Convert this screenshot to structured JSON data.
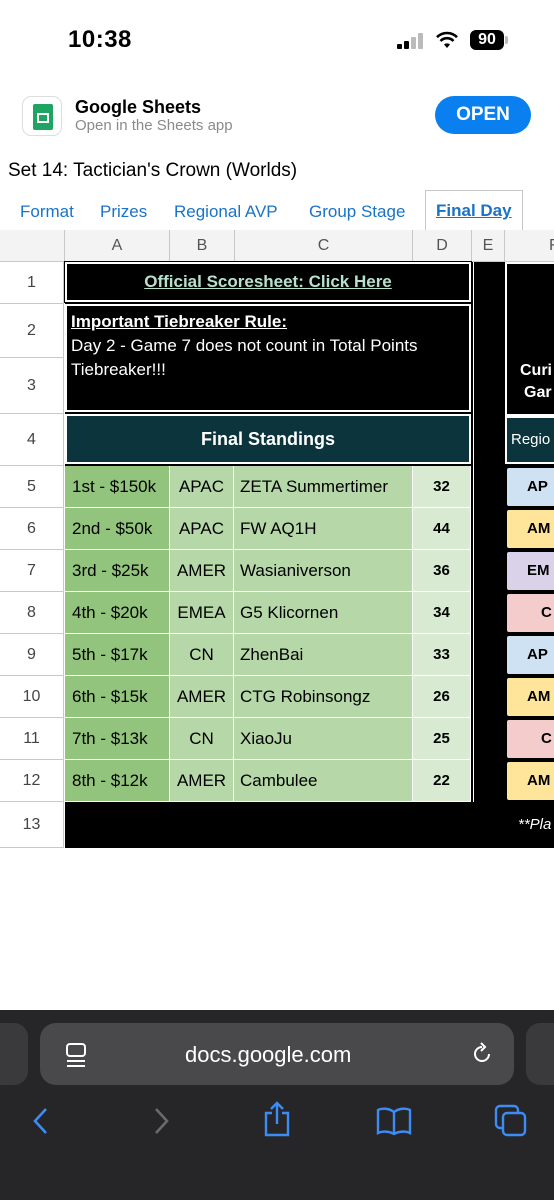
{
  "status": {
    "time": "10:38",
    "battery": "90"
  },
  "banner": {
    "app_name": "Google Sheets",
    "subtitle": "Open in the Sheets app",
    "open_label": "OPEN"
  },
  "doc": {
    "title": "Set 14: Tactician's Crown (Worlds)"
  },
  "tabs": [
    {
      "label": "Format"
    },
    {
      "label": "Prizes"
    },
    {
      "label": "Regional AVP"
    },
    {
      "label": "Group Stage"
    },
    {
      "label": "Final Day"
    }
  ],
  "columns": [
    "A",
    "B",
    "C",
    "D",
    "E",
    "F"
  ],
  "rows": [
    "1",
    "2",
    "3",
    "4",
    "5",
    "6",
    "7",
    "8",
    "9",
    "10",
    "11",
    "12",
    "13"
  ],
  "sheet": {
    "scoresheet_link": "Official Scoresheet: Click Here",
    "rule_heading": "Important Tiebreaker Rule:",
    "rule_text": "Day 2 - Game 7 does not count in Total Points Tiebreaker!!!",
    "standings_title": "Final Standings",
    "standings": [
      {
        "place": "1st - $150k",
        "region": "APAC",
        "player": "ZETA Summertimer",
        "points": "32"
      },
      {
        "place": "2nd - $50k",
        "region": "APAC",
        "player": "FW AQ1H",
        "points": "44"
      },
      {
        "place": "3rd - $25k",
        "region": "AMER",
        "player": "Wasianiverson",
        "points": "36"
      },
      {
        "place": "4th - $20k",
        "region": "EMEA",
        "player": "G5 Klicornen",
        "points": "34"
      },
      {
        "place": "5th - $17k",
        "region": "CN",
        "player": "ZhenBai",
        "points": "33"
      },
      {
        "place": "6th - $15k",
        "region": "AMER",
        "player": "CTG Robinsongz",
        "points": "26"
      },
      {
        "place": "7th - $13k",
        "region": "CN",
        "player": "XiaoJu",
        "points": "25"
      },
      {
        "place": "8th - $12k",
        "region": "AMER",
        "player": "Cambulee",
        "points": "22"
      }
    ],
    "side": {
      "cur_text": "Curi",
      "gam_text": "Gar",
      "region_label": "Regio",
      "cells": [
        {
          "text": "AP",
          "color": "#cfe2f3"
        },
        {
          "text": "AM",
          "color": "#ffe599"
        },
        {
          "text": "EM",
          "color": "#d9d2e9"
        },
        {
          "text": "C",
          "color": "#f4cccc"
        },
        {
          "text": "AP",
          "color": "#cfe2f3"
        },
        {
          "text": "AM",
          "color": "#ffe599"
        },
        {
          "text": "C",
          "color": "#f4cccc"
        },
        {
          "text": "AM",
          "color": "#ffe599"
        }
      ],
      "footnote": "**Pla"
    }
  },
  "browser": {
    "url": "docs.google.com"
  }
}
